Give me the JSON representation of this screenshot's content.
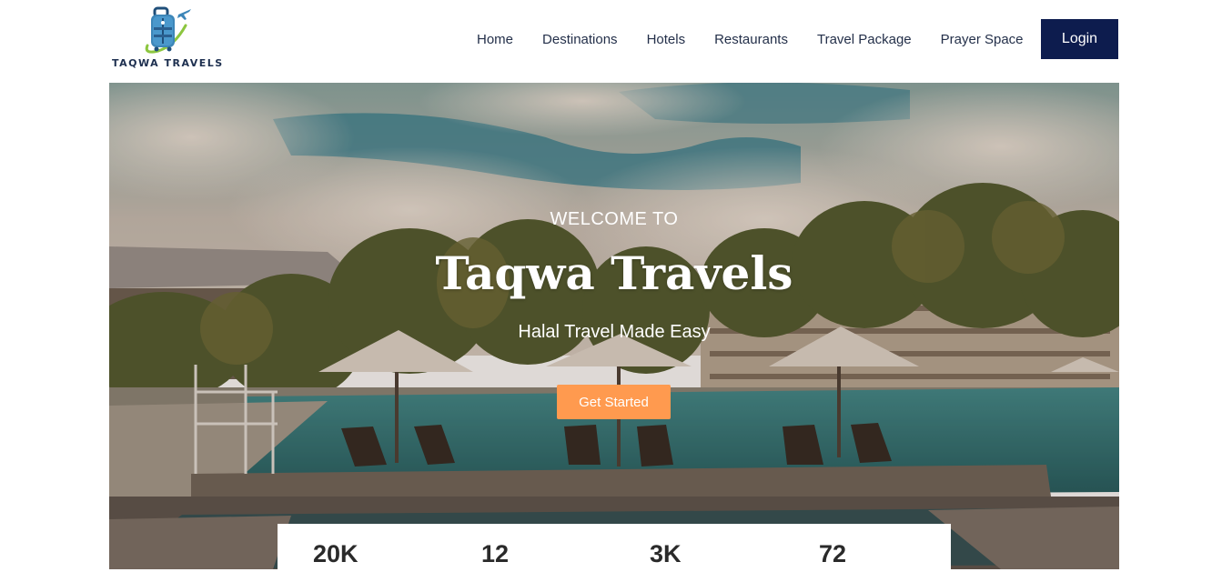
{
  "brand": {
    "name": "TAQWA TRAVELS",
    "logo_icon": "suitcase-airplane-icon",
    "colors": {
      "navy": "#0d1c4e",
      "accent": "#ff9a4f",
      "logo_blue": "#3d86b8",
      "logo_green": "#8cc63f"
    }
  },
  "nav": {
    "items": [
      {
        "label": "Home"
      },
      {
        "label": "Destinations"
      },
      {
        "label": "Hotels"
      },
      {
        "label": "Restaurants"
      },
      {
        "label": "Travel Package"
      },
      {
        "label": "Prayer Space"
      }
    ],
    "login_label": "Login"
  },
  "hero": {
    "welcome": "WELCOME TO",
    "title": "Taqwa Travels",
    "subtitle": "Halal Travel Made Easy",
    "cta_label": "Get Started"
  },
  "stats": [
    {
      "value": "20K"
    },
    {
      "value": "12"
    },
    {
      "value": "3K"
    },
    {
      "value": "72"
    }
  ]
}
